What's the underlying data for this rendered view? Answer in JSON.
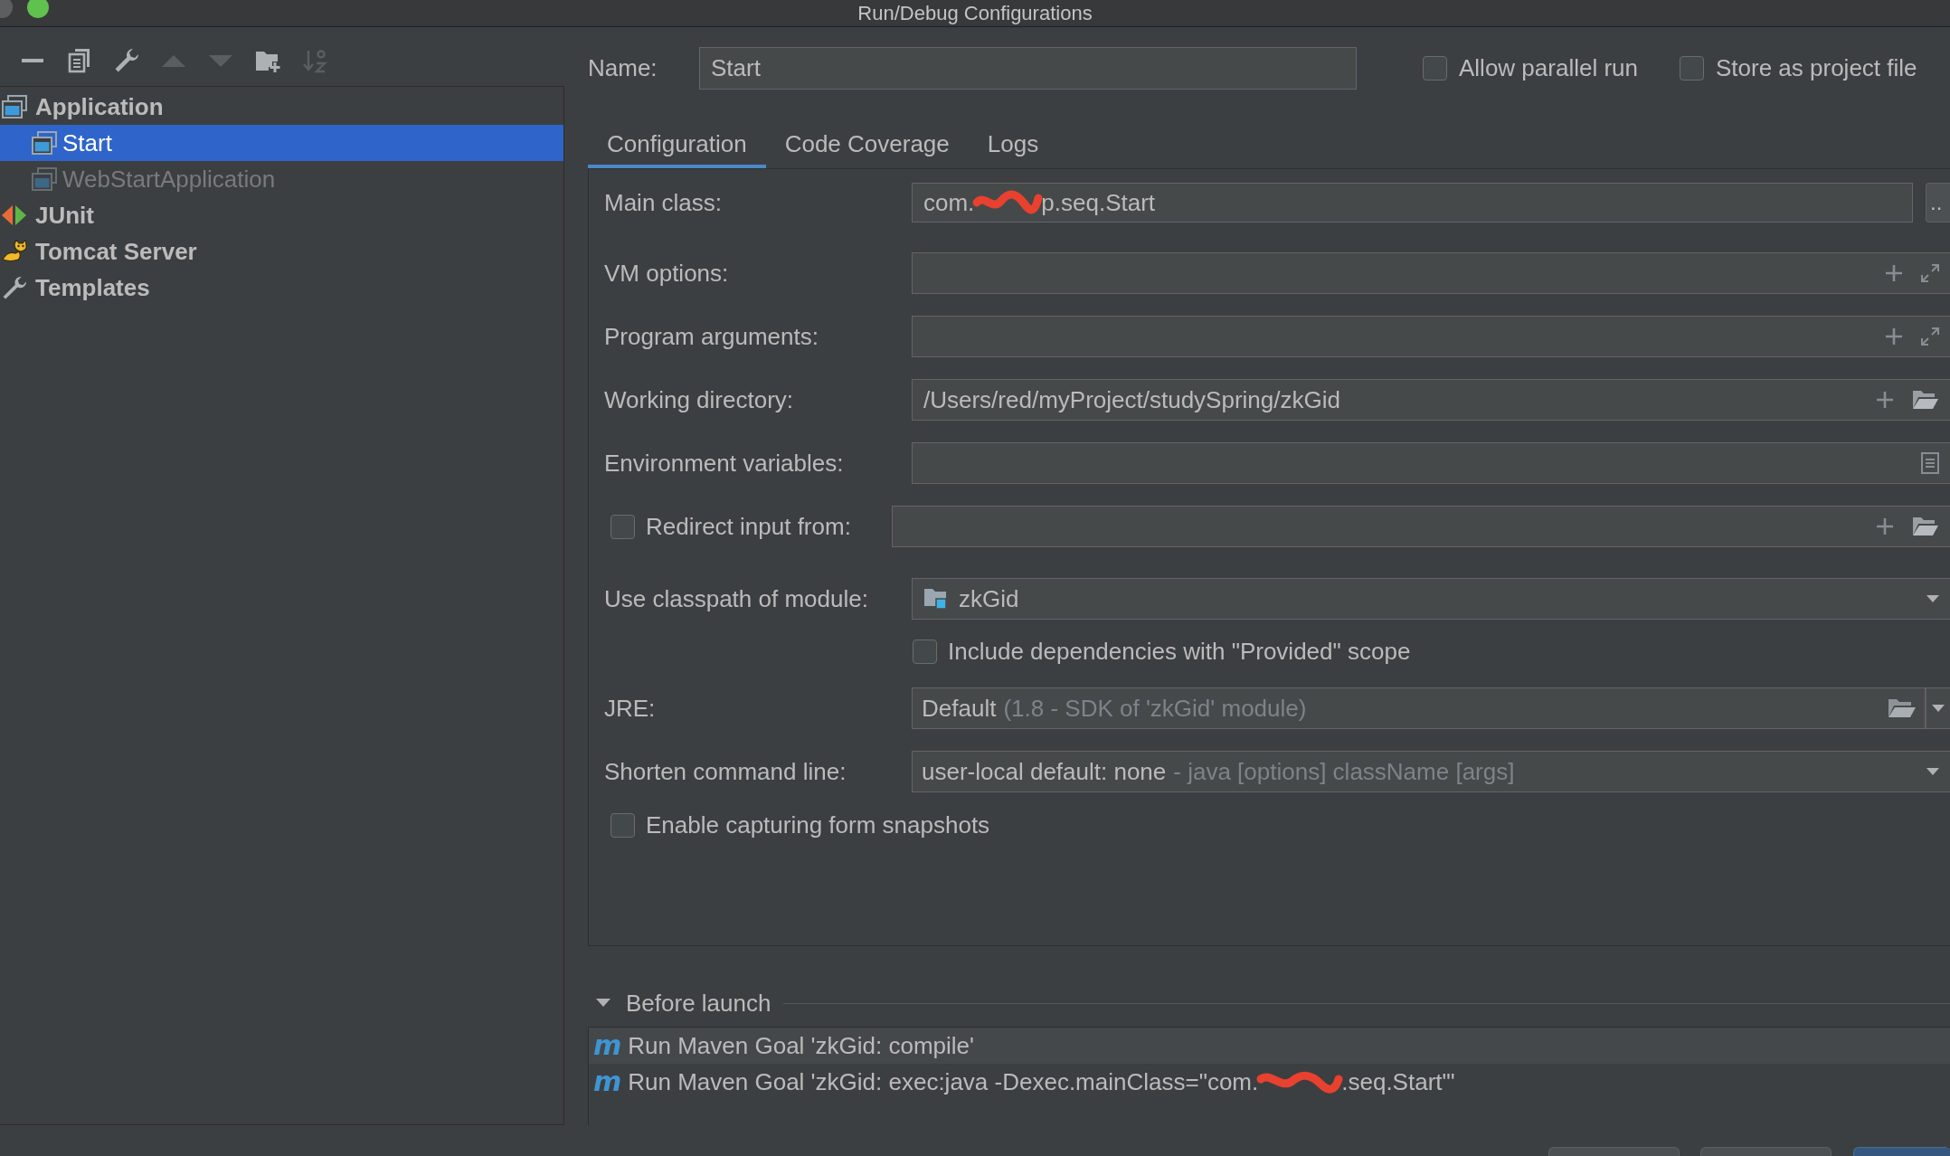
{
  "window": {
    "title": "Run/Debug Configurations"
  },
  "toolbar": [
    {
      "kind": "remove",
      "disabled": false
    },
    {
      "kind": "copy",
      "disabled": false
    },
    {
      "kind": "edit",
      "disabled": false
    },
    {
      "kind": "up",
      "disabled": true
    },
    {
      "kind": "down",
      "disabled": true
    },
    {
      "kind": "folder",
      "disabled": false
    },
    {
      "kind": "sort",
      "disabled": true
    }
  ],
  "tree": [
    {
      "label": "Application",
      "kind": "app",
      "selected": false,
      "disabled": false,
      "children": [
        {
          "label": "Start",
          "kind": "app",
          "selected": true,
          "disabled": false
        },
        {
          "label": "WebStartApplication",
          "kind": "app",
          "selected": false,
          "disabled": true
        }
      ]
    },
    {
      "label": "JUnit",
      "kind": "test",
      "selected": false,
      "disabled": false
    },
    {
      "label": "Tomcat Server",
      "kind": "server",
      "selected": false,
      "disabled": false
    },
    {
      "label": "Templates",
      "kind": "template",
      "selected": false,
      "disabled": false
    }
  ],
  "name_field": {
    "label": "Name:",
    "value": "Start"
  },
  "options": [
    {
      "label": "Allow parallel run",
      "checked": false
    },
    {
      "label": "Store as project file",
      "checked": false
    }
  ],
  "tabs": [
    {
      "label": "Configuration",
      "selected": true
    },
    {
      "label": "Code Coverage",
      "selected": false
    },
    {
      "label": "Logs",
      "selected": false
    }
  ],
  "form": [
    {
      "kind": "class",
      "label": "Main class:",
      "value_parts": [
        "com.",
        "p.seq.Start"
      ],
      "button": ".."
    },
    {
      "kind": "expandable",
      "label": "VM options:"
    },
    {
      "kind": "expandable",
      "label": "Program arguments:"
    },
    {
      "kind": "path",
      "label": "Working directory:",
      "value": "/Users/red/myProject/studySpring/zkGid"
    },
    {
      "kind": "env",
      "label": "Environment variables:"
    },
    {
      "kind": "redirect",
      "label": "Redirect input from:",
      "checked": false
    },
    {
      "kind": "module",
      "label": "Use classpath of module:",
      "value": "zkGid"
    },
    {
      "kind": "option",
      "label": "Include dependencies with \"Provided\" scope",
      "checked": false
    },
    {
      "kind": "jre",
      "label": "JRE:",
      "value": "Default",
      "hint": "(1.8 - SDK of 'zkGid' module)"
    },
    {
      "kind": "select",
      "label": "Shorten command line:",
      "value": "user-local default: none",
      "hint": "- java [options] className [args]"
    },
    {
      "kind": "checkbox",
      "label": "Enable capturing form snapshots",
      "checked": false
    }
  ],
  "before_launch": {
    "title": "Before launch",
    "expanded": true,
    "tasks": [
      {
        "icon": "m",
        "text_parts": [
          "Run Maven Goal 'zkGid: compile'"
        ],
        "selected": true
      },
      {
        "icon": "m",
        "text_parts": [
          "Run Maven Goal 'zkGid: exec:java -Dexec.mainClass=\"com.",
          ".seq.Start\"'"
        ],
        "selected": false
      }
    ]
  },
  "dialog_buttons": [
    {
      "default": false
    },
    {
      "default": false
    },
    {
      "default": true
    }
  ]
}
